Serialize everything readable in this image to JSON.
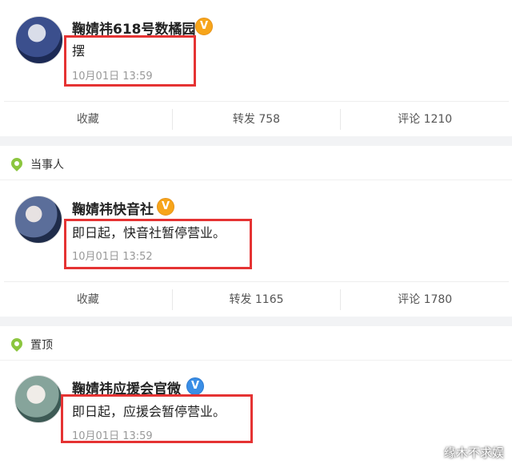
{
  "posts": [
    {
      "author": "鞠婧祎618号数橘园",
      "verified_color": "#f7a51a",
      "text": "摆",
      "time": "10月01日 13:59"
    },
    {
      "author": "鞠婧祎快音社",
      "verified_color": "#f7a51a",
      "text": "即日起，快音社暂停营业。",
      "time": "10月01日 13:52"
    },
    {
      "author": "鞠婧祎应援会官微",
      "verified_color": "#3a8ee6",
      "text": "即日起，应援会暂停营业。",
      "time": "10月01日 13:59"
    }
  ],
  "action_bars": [
    {
      "collect": "收藏",
      "repost": "转发 758",
      "comment": "评论 1210"
    },
    {
      "collect": "收藏",
      "repost": "转发 1165",
      "comment": "评论 1780"
    }
  ],
  "labels": {
    "party": "当事人",
    "pinned": "置顶"
  },
  "badge_glyph": "V",
  "highlight_color": "#e53333",
  "watermark": "缘木不求娱"
}
